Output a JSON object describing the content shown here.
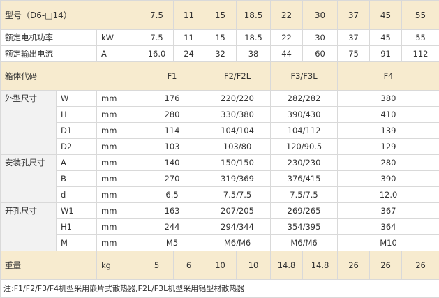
{
  "header": {
    "model_label": "型号（D6-□14）",
    "models": [
      "7.5",
      "11",
      "15",
      "18.5",
      "22",
      "30",
      "37",
      "45",
      "55"
    ]
  },
  "power": {
    "label": "额定电机功率",
    "unit": "kW",
    "values": [
      "7.5",
      "11",
      "15",
      "18.5",
      "22",
      "30",
      "37",
      "45",
      "55"
    ]
  },
  "current": {
    "label": "额定输出电流",
    "unit": "A",
    "values": [
      "16.0",
      "24",
      "32",
      "38",
      "44",
      "60",
      "75",
      "91",
      "112"
    ]
  },
  "box": {
    "label": "箱体代码",
    "codes": [
      "F1",
      "F2/F2L",
      "F3/F3L",
      "F4"
    ]
  },
  "outer": {
    "label": "外型尺寸",
    "rows": [
      {
        "dim": "W",
        "unit": "mm",
        "values": [
          "176",
          "220/220",
          "282/282",
          "380"
        ]
      },
      {
        "dim": "H",
        "unit": "mm",
        "values": [
          "280",
          "330/380",
          "390/430",
          "410"
        ]
      },
      {
        "dim": "D1",
        "unit": "mm",
        "values": [
          "114",
          "104/104",
          "104/112",
          "139"
        ]
      },
      {
        "dim": "D2",
        "unit": "mm",
        "values": [
          "103",
          "103/80",
          "120/90.5",
          "129"
        ]
      }
    ]
  },
  "mount": {
    "label": "安装孔尺寸",
    "rows": [
      {
        "dim": "A",
        "unit": "mm",
        "values": [
          "140",
          "150/150",
          "230/230",
          "280"
        ]
      },
      {
        "dim": "B",
        "unit": "mm",
        "values": [
          "270",
          "319/369",
          "376/415",
          "390"
        ]
      },
      {
        "dim": "d",
        "unit": "mm",
        "values": [
          "6.5",
          "7.5/7.5",
          "7.5/7.5",
          "12.0"
        ]
      }
    ]
  },
  "cutout": {
    "label": "开孔尺寸",
    "rows": [
      {
        "dim": "W1",
        "unit": "mm",
        "values": [
          "163",
          "207/205",
          "269/265",
          "367"
        ]
      },
      {
        "dim": "H1",
        "unit": "mm",
        "values": [
          "244",
          "294/344",
          "354/395",
          "364"
        ]
      },
      {
        "dim": "M",
        "unit": "mm",
        "values": [
          "M5",
          "M6/M6",
          "M6/M6",
          "M10"
        ]
      }
    ]
  },
  "weight": {
    "label": "重量",
    "unit": "kg",
    "values": [
      "5",
      "6",
      "10",
      "10",
      "14.8",
      "14.8",
      "26",
      "26",
      "26"
    ]
  },
  "note": "注:F1/F2/F3/F4机型采用嵌片式散热器,F2L/F3L机型采用铝型材散热器",
  "colors": {
    "band": "#f7ebcf",
    "group": "#f2f2f2",
    "border": "#d9d9d9",
    "text": "#333333"
  }
}
